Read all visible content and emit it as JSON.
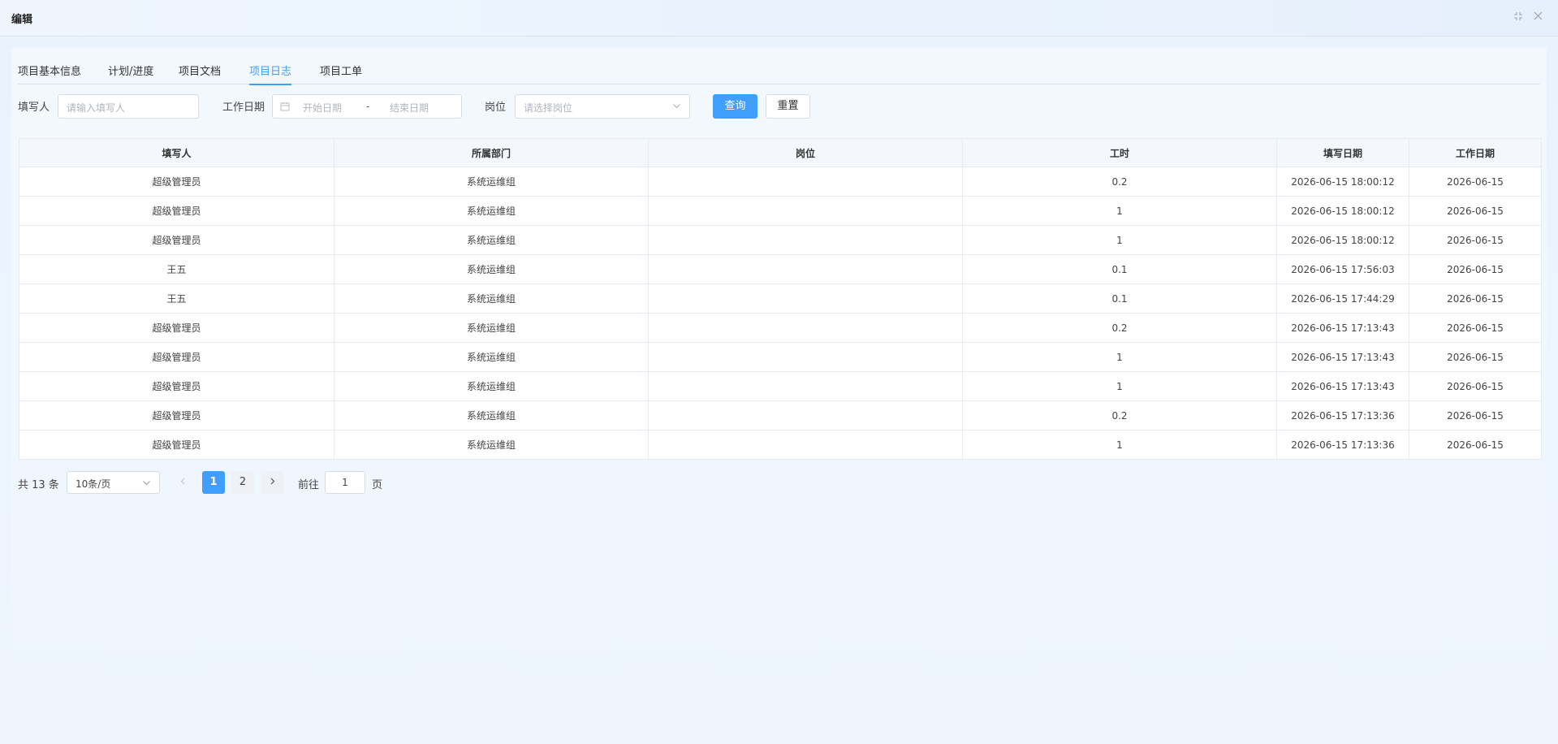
{
  "dialog": {
    "title": "编辑"
  },
  "tabs": [
    {
      "label": "项目基本信息"
    },
    {
      "label": "计划/进度"
    },
    {
      "label": "项目文档"
    },
    {
      "label": "项目日志"
    },
    {
      "label": "项目工单"
    }
  ],
  "filters": {
    "writer_label": "填写人",
    "writer_placeholder": "请输入填写人",
    "workdate_label": "工作日期",
    "start_placeholder": "开始日期",
    "range_sep": "-",
    "end_placeholder": "结束日期",
    "position_label": "岗位",
    "position_placeholder": "请选择岗位",
    "query_label": "查询",
    "reset_label": "重置"
  },
  "table": {
    "columns": [
      "填写人",
      "所属部门",
      "岗位",
      "工时",
      "填写日期",
      "工作日期"
    ],
    "rows": [
      [
        "超级管理员",
        "系统运维组",
        "",
        "0.2",
        "2026-06-15 18:00:12",
        "2026-06-15"
      ],
      [
        "超级管理员",
        "系统运维组",
        "",
        "1",
        "2026-06-15 18:00:12",
        "2026-06-15"
      ],
      [
        "超级管理员",
        "系统运维组",
        "",
        "1",
        "2026-06-15 18:00:12",
        "2026-06-15"
      ],
      [
        "王五",
        "系统运维组",
        "",
        "0.1",
        "2026-06-15 17:56:03",
        "2026-06-15"
      ],
      [
        "王五",
        "系统运维组",
        "",
        "0.1",
        "2026-06-15 17:44:29",
        "2026-06-15"
      ],
      [
        "超级管理员",
        "系统运维组",
        "",
        "0.2",
        "2026-06-15 17:13:43",
        "2026-06-15"
      ],
      [
        "超级管理员",
        "系统运维组",
        "",
        "1",
        "2026-06-15 17:13:43",
        "2026-06-15"
      ],
      [
        "超级管理员",
        "系统运维组",
        "",
        "1",
        "2026-06-15 17:13:43",
        "2026-06-15"
      ],
      [
        "超级管理员",
        "系统运维组",
        "",
        "0.2",
        "2026-06-15 17:13:36",
        "2026-06-15"
      ],
      [
        "超级管理员",
        "系统运维组",
        "",
        "1",
        "2026-06-15 17:13:36",
        "2026-06-15"
      ]
    ]
  },
  "pagination": {
    "total_text": "共 13 条",
    "page_size": "10条/页",
    "pages": [
      "1",
      "2"
    ],
    "current_page": "1",
    "goto_prefix": "前往",
    "goto_value": "1",
    "goto_suffix": "页"
  },
  "icons": {
    "minimize": "shrink-icon",
    "close": "close-icon",
    "calendar": "calendar-icon",
    "dropdown": "chevron-down-icon",
    "prev": "chevron-left-icon",
    "next": "chevron-right-icon"
  },
  "colors": {
    "accent": "#409eff"
  }
}
